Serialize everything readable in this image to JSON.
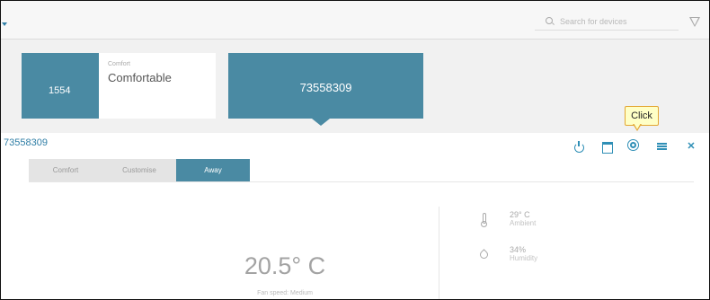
{
  "search": {
    "placeholder": "Search for devices"
  },
  "tiles": [
    {
      "number": "1554"
    },
    {
      "small_label": "Comfort",
      "big_label": "Comfortable"
    },
    {
      "number": "73558309"
    }
  ],
  "callout": {
    "text": "Click"
  },
  "panel": {
    "device_id": "73558309",
    "toolbar_icons": [
      "power-icon",
      "calendar-icon",
      "gear-icon",
      "list-icon",
      "close-icon"
    ],
    "close_glyph": "✕",
    "tabs": [
      {
        "label": "Comfort",
        "active": false
      },
      {
        "label": "Customise",
        "active": false
      },
      {
        "label": "Away",
        "active": true
      }
    ],
    "setpoint": "20.5° C",
    "fan_speed": "Fan speed: Medium",
    "stats": [
      {
        "icon": "thermometer-icon",
        "value": "29° C",
        "label": "Ambient"
      },
      {
        "icon": "humidity-drop-icon",
        "value": "34%",
        "label": "Humidity"
      }
    ]
  },
  "colors": {
    "accent": "#4a8aa3",
    "icon_blue": "#2f8fb6",
    "callout_bg": "#ffffc6",
    "callout_border": "#e3a632"
  }
}
